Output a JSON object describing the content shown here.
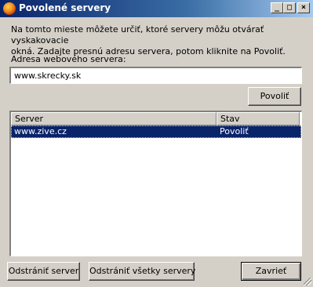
{
  "window": {
    "title": "Povolené servery",
    "minimize_glyph": "_",
    "maximize_glyph": "□",
    "close_glyph": "×"
  },
  "intro_text": "Na tomto mieste môžete určiť, ktoré servery môžu otvárať vyskakovacie\nokná. Zadajte presnú adresu servera, potom kliknite na Povoliť.",
  "address": {
    "label": "Adresa webového servera:",
    "value": "www.skrecky.sk"
  },
  "buttons": {
    "allow": "Povoliť",
    "remove": "Odstrániť server",
    "remove_all": "Odstrániť všetky servery",
    "close": "Zavrieť"
  },
  "table": {
    "columns": [
      "Server",
      "Stav"
    ],
    "rows": [
      {
        "server": "www.zive.cz",
        "status": "Povoliť",
        "selected": true
      }
    ]
  },
  "colors": {
    "selection": "#0a246a",
    "face": "#d4d0c8",
    "title_start": "#0a246a",
    "title_end": "#a6caf0"
  },
  "icons": {
    "app": "firefox-icon"
  }
}
